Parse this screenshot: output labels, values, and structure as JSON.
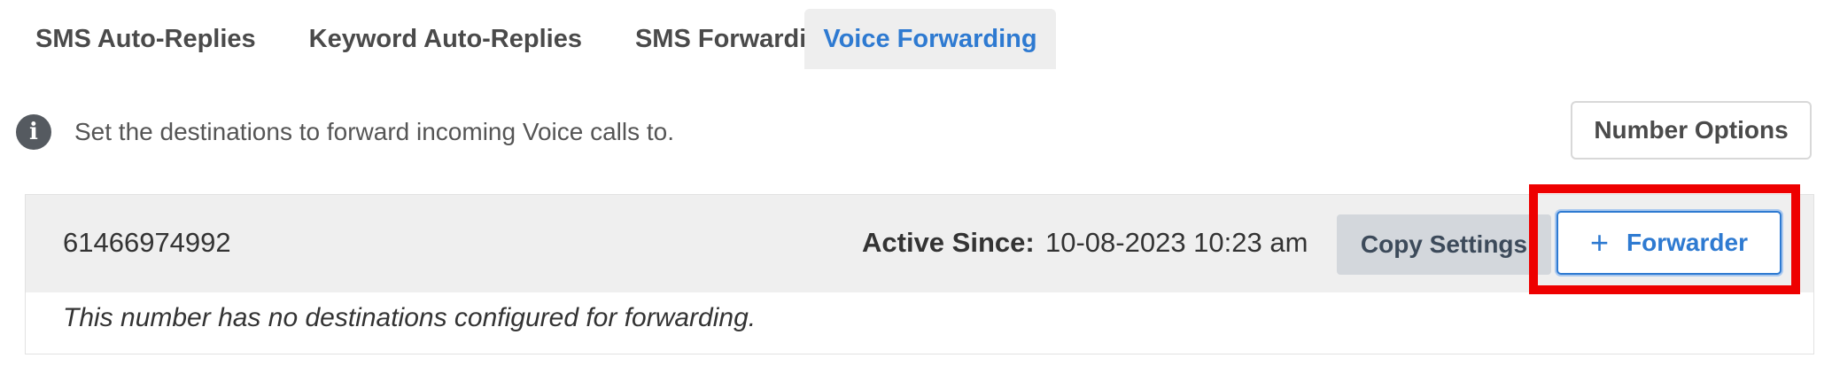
{
  "tabs": [
    {
      "label": "SMS Auto-Replies",
      "active": false
    },
    {
      "label": "Keyword Auto-Replies",
      "active": false
    },
    {
      "label": "SMS Forwarding",
      "active": false
    },
    {
      "label": "Voice Forwarding",
      "active": true
    }
  ],
  "info": {
    "icon": "info-icon",
    "icon_glyph": "i",
    "text": "Set the destinations to forward incoming Voice calls to."
  },
  "number_options_label": "Number Options",
  "number_row": {
    "number": "61466974992",
    "active_since_label": "Active Since:",
    "active_since_value": "10-08-2023 10:23 am",
    "copy_settings_label": "Copy Settings",
    "forwarder_icon": "plus",
    "forwarder_icon_glyph": "+",
    "forwarder_label": "Forwarder",
    "empty_message": "This number has no destinations configured for forwarding."
  },
  "colors": {
    "accent": "#2e7ad1",
    "highlight": "#ee0000",
    "tab_active_bg": "#eeeeee"
  }
}
